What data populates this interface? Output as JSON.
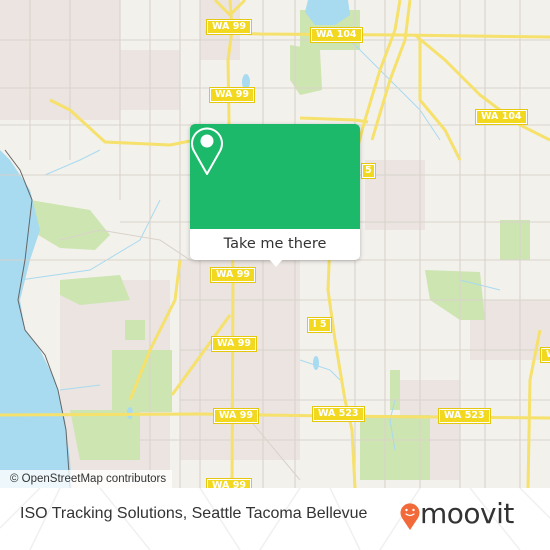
{
  "map": {
    "attribution": "© OpenStreetMap contributors",
    "colors": {
      "land": "#f3f1ec",
      "water": "#a8daf0",
      "park": "#cde5b0",
      "residential": "#ebe4e0",
      "road_major": "#f5e16b",
      "road_minor": "#d9d3cc",
      "shield_bg": "#f2d91f"
    },
    "road_labels": [
      {
        "id": "wa99-top",
        "text": "WA 99"
      },
      {
        "id": "wa104-top",
        "text": "WA 104"
      },
      {
        "id": "wa99-upper",
        "text": "WA 99"
      },
      {
        "id": "wa104-right",
        "text": "WA 104"
      },
      {
        "id": "i5-partial",
        "text": "5"
      },
      {
        "id": "wa99-mid",
        "text": "WA 99"
      },
      {
        "id": "i5",
        "text": "I 5"
      },
      {
        "id": "wa99-lower",
        "text": "WA 99"
      },
      {
        "id": "wa99-bottom",
        "text": "WA 99"
      },
      {
        "id": "wa523-left",
        "text": "WA 523"
      },
      {
        "id": "wa523-right",
        "text": "WA 523"
      },
      {
        "id": "w-edge",
        "text": "W"
      },
      {
        "id": "wa99-cut",
        "text": "WA 99"
      }
    ]
  },
  "popup": {
    "icon": "map-pin-icon",
    "button_label": "Take me there",
    "color": "#1db96a"
  },
  "footer": {
    "place_name": "ISO Tracking Solutions, Seattle Tacoma Bellevue",
    "brand": "moovit",
    "brand_icon": "moovit-pin-logo-icon",
    "brand_color": "#f26a3a"
  }
}
